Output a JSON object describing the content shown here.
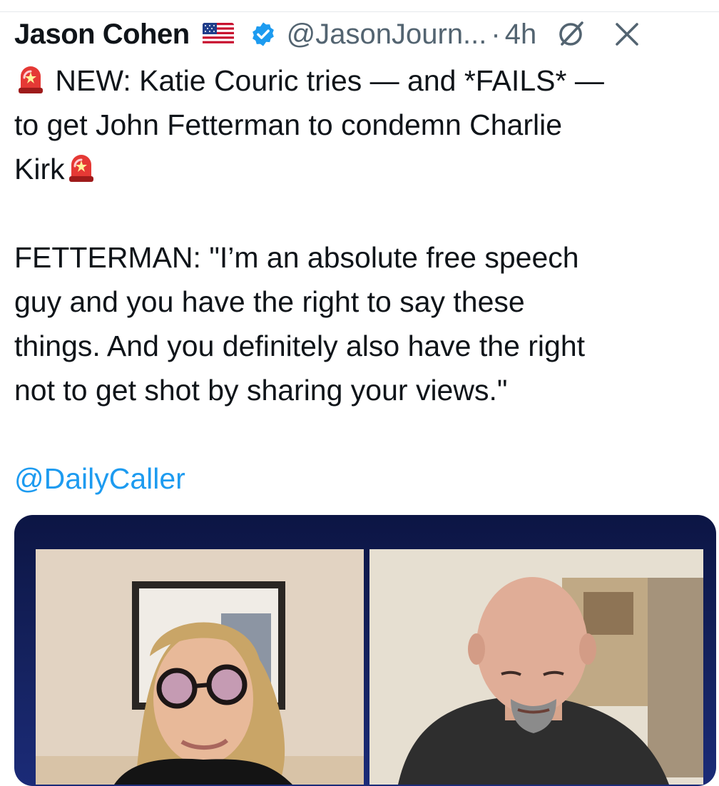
{
  "tweet": {
    "author_name": "Jason Cohen",
    "flag_emoji": "us-flag",
    "handle": "@JasonJourn...",
    "separator": "·",
    "time": "4h",
    "text_line1": "NEW: Katie Couric tries — and *FAILS* —",
    "text_line2": "to get John Fetterman to condemn Charlie",
    "text_line3": "Kirk",
    "quote_line1": "FETTERMAN: \"I’m an absolute free speech",
    "quote_line2": "guy and you have the right to say these",
    "quote_line3": "things. And you definitely also have the right",
    "quote_line4": "not to get shot by sharing your views.\"",
    "mention": "@DailyCaller"
  },
  "icons": {
    "verified": "verified-badge-icon",
    "grok": "grok-icon",
    "close": "close-icon",
    "siren": "police-siren-emoji"
  },
  "colors": {
    "text": "#0f1419",
    "secondary": "#536471",
    "link": "#1d9bf0",
    "verified": "#1d9bf0",
    "media_border": "#0c1544"
  }
}
